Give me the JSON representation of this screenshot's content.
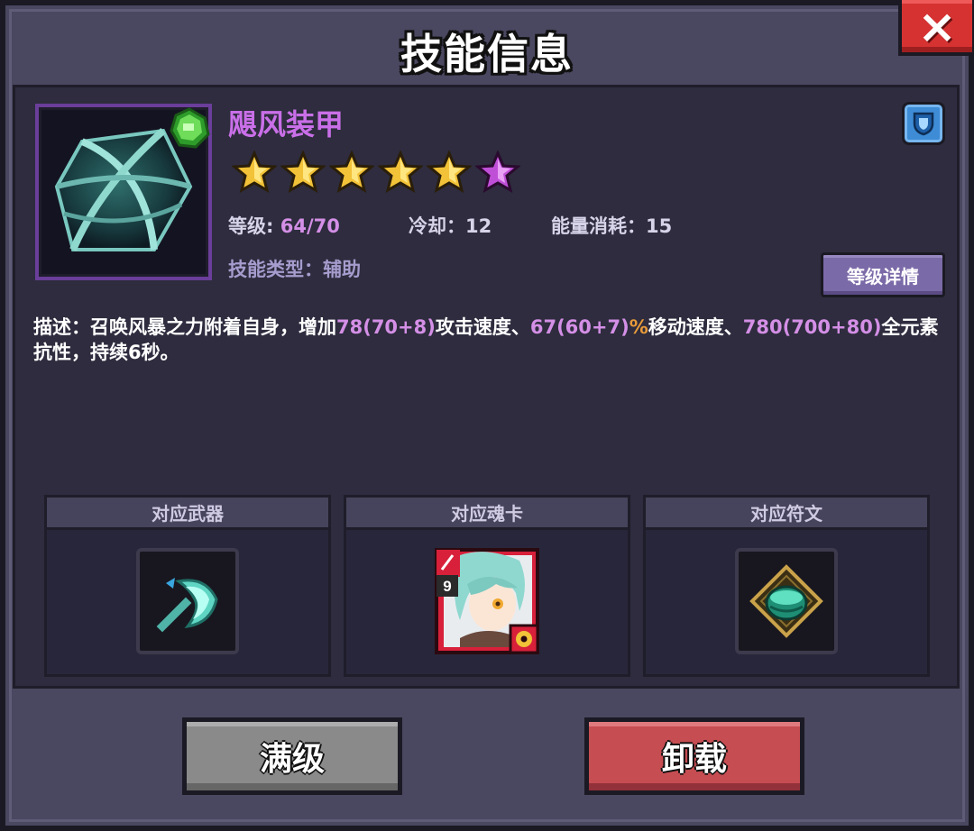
{
  "dialog": {
    "title": "技能信息",
    "close_icon": "×"
  },
  "skill": {
    "name": "飓风装甲",
    "stars_gold": 5,
    "stars_purple": 1,
    "level_label": "等级:",
    "level_value": "64/70",
    "cooldown_label": "冷却：",
    "cooldown_value": "12",
    "energy_label": "能量消耗：",
    "energy_value": "15",
    "type_label": "技能类型：",
    "type_value": "辅助",
    "level_detail_button": "等级详情",
    "name_color": "#c96fe8"
  },
  "description": {
    "prefix": "描述：召唤风暴之力附着自身，增加",
    "v1": "78(70+8)",
    "t1": "攻击速度、",
    "v2": "67(60+7)",
    "pct": "%",
    "t2": "移动速度、",
    "v3": "780(700+80)",
    "t3": "全元素抗性，持续6秒。"
  },
  "slots": {
    "weapon_title": "对应武器",
    "card_title": "对应魂卡",
    "rune_title": "对应符文",
    "card_level": "9"
  },
  "buttons": {
    "max_level": "满级",
    "unload": "卸载"
  }
}
